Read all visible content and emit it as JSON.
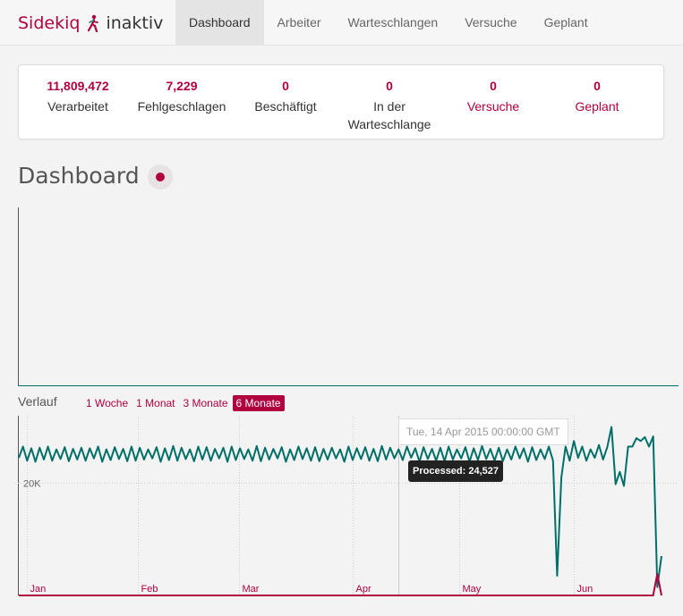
{
  "brand": {
    "name": "Sidekiq",
    "status": "inaktiv",
    "icon": "sidekiq-runner-icon",
    "color": "#b1003e"
  },
  "nav": {
    "items": [
      {
        "label": "Dashboard",
        "active": true
      },
      {
        "label": "Arbeiter",
        "active": false
      },
      {
        "label": "Warteschlangen",
        "active": false
      },
      {
        "label": "Versuche",
        "active": false
      },
      {
        "label": "Geplant",
        "active": false
      }
    ]
  },
  "summary": {
    "processed": {
      "count": "11,809,472",
      "label": "Verarbeitet"
    },
    "failed": {
      "count": "7,229",
      "label": "Fehlgeschlagen"
    },
    "busy": {
      "count": "0",
      "label": "Beschäftigt"
    },
    "enqueued": {
      "count": "0",
      "label": "In der Warteschlange"
    },
    "retries": {
      "count": "0",
      "label": "Versuche"
    },
    "scheduled": {
      "count": "0",
      "label": "Geplant"
    }
  },
  "dashboard": {
    "title": "Dashboard"
  },
  "history": {
    "label": "Verlauf",
    "ranges": [
      {
        "label": "1 Woche",
        "active": false
      },
      {
        "label": "1 Monat",
        "active": false
      },
      {
        "label": "3 Monate",
        "active": false
      },
      {
        "label": "6 Monate",
        "active": true
      }
    ]
  },
  "tooltip": {
    "date": "Tue, 14 Apr 2015 00:00:00 GMT",
    "value": "Processed: 24,527"
  },
  "chart_data": {
    "type": "line",
    "x_ticks": [
      "Jan",
      "Feb",
      "Mar",
      "Apr",
      "May",
      "Jun"
    ],
    "y_ticks": [
      "20K"
    ],
    "ylim": [
      0,
      32000
    ],
    "grid": true,
    "colors": {
      "processed": "#006f68",
      "failed": "#b1003e"
    },
    "series": [
      {
        "key": "processed",
        "values": [
          24500,
          26500,
          24000,
          26200,
          23800,
          26300,
          24200,
          26500,
          24000,
          26000,
          24300,
          26400,
          23900,
          26100,
          24200,
          26300,
          24000,
          26200,
          24400,
          26500,
          23800,
          26000,
          24100,
          26400,
          24300,
          26100,
          23900,
          26500,
          24000,
          26300,
          24200,
          26000,
          24400,
          26400,
          23800,
          26200,
          24100,
          26600,
          24000,
          26300,
          24300,
          26000,
          23900,
          26500,
          24200,
          26400,
          24000,
          26100,
          24400,
          26300,
          23800,
          26500,
          24100,
          26200,
          24300,
          26000,
          24000,
          26600,
          23900,
          26300,
          24200,
          26100,
          24400,
          26400,
          23800,
          26000,
          24100,
          26500,
          24300,
          26200,
          24000,
          26400,
          23900,
          26100,
          24200,
          26300,
          24400,
          26000,
          23800,
          26500,
          24100,
          26200,
          24300,
          26400,
          24000,
          26100,
          23900,
          26600,
          24200,
          26300,
          24400,
          26000,
          24100,
          26500,
          24527,
          26200,
          23800,
          26400,
          24300,
          26100,
          24000,
          26300,
          23900,
          26500,
          24200,
          26000,
          24400,
          26400,
          23800,
          26200,
          24100,
          26600,
          24300,
          26100,
          24000,
          26300,
          23900,
          26000,
          24200,
          26500,
          24400,
          26200,
          23800,
          26400,
          24100,
          26000,
          24300,
          26500,
          24000,
          3500,
          21000,
          26500,
          24000,
          27500,
          24500,
          26500,
          24000,
          26000,
          24500,
          26800,
          24200,
          26400,
          30000,
          19800,
          22000,
          19500,
          26500,
          26500,
          28000,
          27500,
          28200,
          26500,
          28300,
          1500,
          7000
        ]
      },
      {
        "key": "failed",
        "values": [
          0,
          0,
          0,
          0,
          0,
          0,
          0,
          0,
          0,
          0,
          0,
          0,
          0,
          0,
          0,
          0,
          0,
          0,
          0,
          0,
          0,
          0,
          0,
          0,
          0,
          0,
          0,
          0,
          0,
          0,
          0,
          0,
          0,
          0,
          0,
          0,
          0,
          0,
          0,
          0,
          0,
          0,
          0,
          0,
          0,
          0,
          0,
          0,
          0,
          0,
          0,
          0,
          0,
          0,
          0,
          0,
          0,
          0,
          0,
          0,
          0,
          0,
          0,
          0,
          0,
          0,
          0,
          0,
          0,
          0,
          0,
          0,
          0,
          0,
          0,
          0,
          0,
          0,
          0,
          0,
          0,
          0,
          0,
          0,
          0,
          0,
          0,
          0,
          0,
          0,
          0,
          0,
          0,
          0,
          0,
          0,
          0,
          0,
          0,
          0,
          0,
          0,
          0,
          0,
          0,
          0,
          0,
          0,
          0,
          0,
          0,
          0,
          0,
          0,
          0,
          0,
          0,
          0,
          0,
          0,
          0,
          0,
          0,
          0,
          0,
          0,
          0,
          0,
          0,
          0,
          0,
          0,
          0,
          0,
          0,
          0,
          0,
          0,
          0,
          0,
          0,
          0,
          0,
          0,
          0,
          0,
          0,
          0,
          0,
          0,
          0,
          3800,
          0
        ]
      }
    ]
  }
}
